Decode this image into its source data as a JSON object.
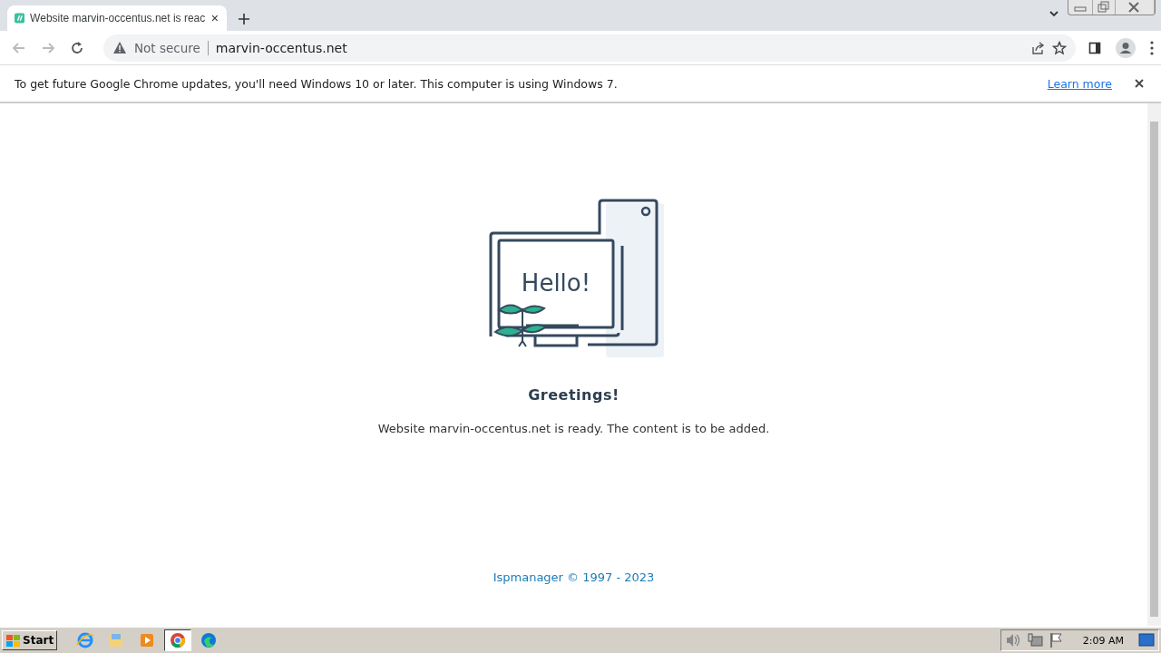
{
  "tab": {
    "title": "Website marvin-occentus.net is reac",
    "selected": true
  },
  "address_bar": {
    "security": "Not secure",
    "url": "marvin-occentus.net"
  },
  "infobar": {
    "message": "To get future Google Chrome updates, you'll need Windows 10 or later. This computer is using Windows 7.",
    "link": "Learn more"
  },
  "page": {
    "illustration_text": "Hello!",
    "heading": "Greetings!",
    "message": "Website marvin-occentus.net is ready. The content is to be added.",
    "footer": "Ispmanager © 1997 - 2023"
  },
  "taskbar": {
    "start": "Start",
    "apps": [
      {
        "kind": "ie",
        "selected": false
      },
      {
        "kind": "folder",
        "selected": false
      },
      {
        "kind": "media",
        "selected": false
      },
      {
        "kind": "chrome",
        "selected": true
      },
      {
        "kind": "edge",
        "selected": false
      }
    ],
    "clock": "2:09 AM"
  }
}
